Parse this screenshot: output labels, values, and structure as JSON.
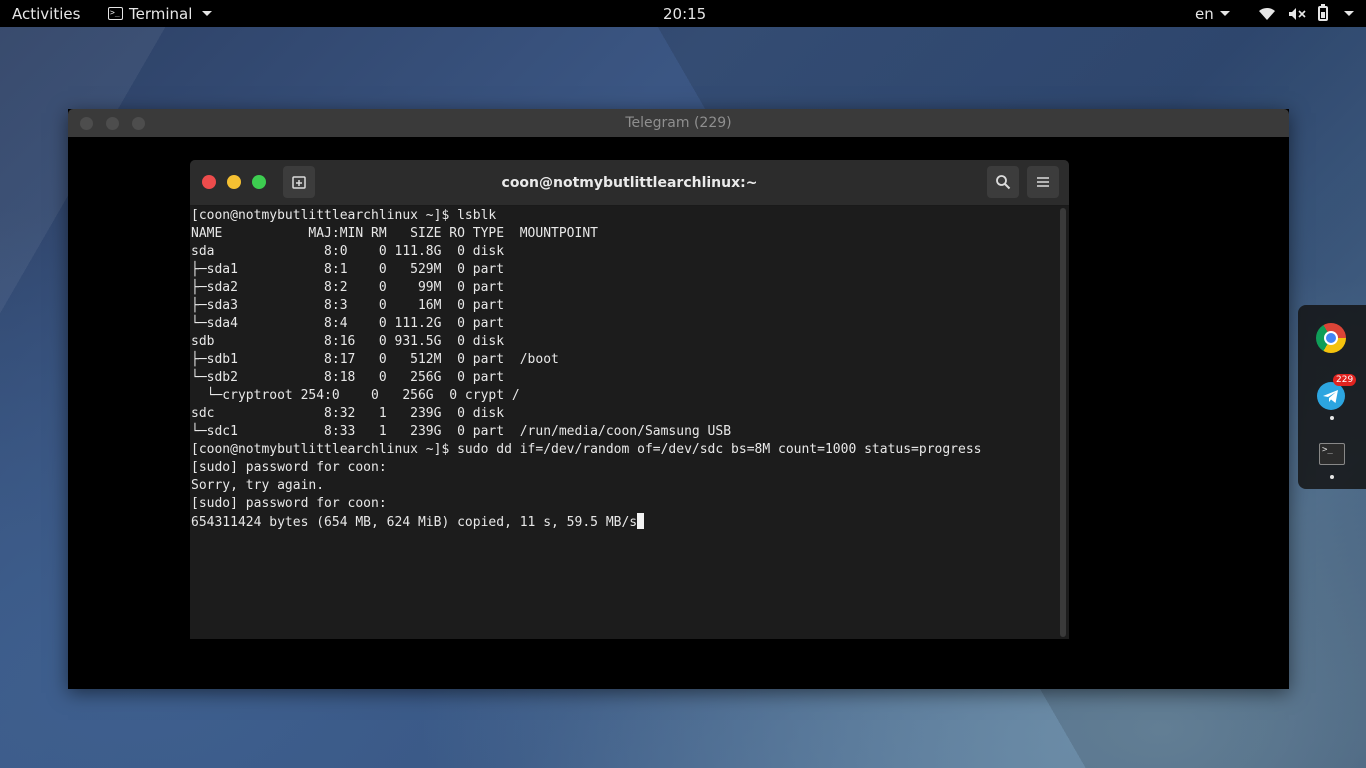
{
  "topbar": {
    "activities": "Activities",
    "app_menu_label": "Terminal",
    "clock": "20:15",
    "language": "en"
  },
  "telegram_window": {
    "title": "Telegram (229)"
  },
  "terminal": {
    "title": "coon@notmybutlittlearchlinux:~",
    "lines": [
      "[coon@notmybutlittlearchlinux ~]$ lsblk",
      "NAME           MAJ:MIN RM   SIZE RO TYPE  MOUNTPOINT",
      "sda              8:0    0 111.8G  0 disk",
      "├─sda1           8:1    0   529M  0 part",
      "├─sda2           8:2    0    99M  0 part",
      "├─sda3           8:3    0    16M  0 part",
      "└─sda4           8:4    0 111.2G  0 part",
      "sdb              8:16   0 931.5G  0 disk",
      "├─sdb1           8:17   0   512M  0 part  /boot",
      "└─sdb2           8:18   0   256G  0 part",
      "  └─cryptroot 254:0    0   256G  0 crypt /",
      "sdc              8:32   1   239G  0 disk",
      "└─sdc1           8:33   1   239G  0 part  /run/media/coon/Samsung USB",
      "[coon@notmybutlittlearchlinux ~]$ sudo dd if=/dev/random of=/dev/sdc bs=8M count=1000 status=progress",
      "[sudo] password for coon:",
      "Sorry, try again.",
      "[sudo] password for coon:"
    ],
    "last_line": "654311424 bytes (654 MB, 624 MiB) copied, 11 s, 59.5 MB/s"
  },
  "dock": {
    "apps": [
      {
        "name": "Google Chrome",
        "icon": "chrome-icon",
        "running": false
      },
      {
        "name": "Telegram",
        "icon": "telegram-icon",
        "badge": "229",
        "running": true
      },
      {
        "name": "Terminal",
        "icon": "terminal-icon",
        "running": true
      }
    ]
  },
  "colors": {
    "close": "#ed4c4c",
    "minimize": "#f5c032",
    "maximize": "#3dcd50",
    "telegram_blue": "#2ca5e0",
    "badge_red": "#e0231f"
  }
}
